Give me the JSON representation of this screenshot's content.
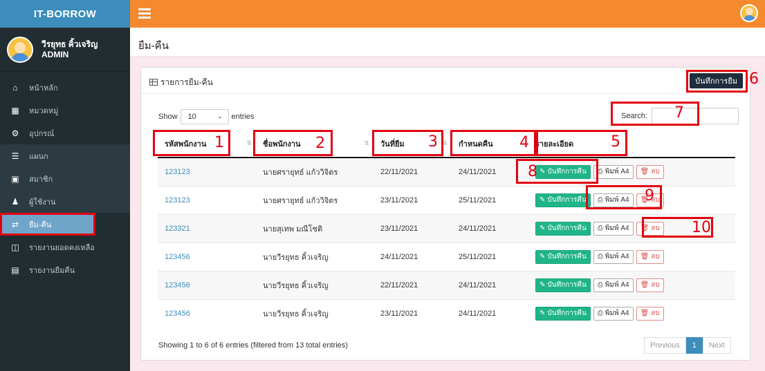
{
  "brand": "IT-BORROW",
  "user": {
    "name": "วีรยุทธ คิ้วเจริญ",
    "role": "ADMIN"
  },
  "menu": [
    {
      "label": "หน้าหลัก",
      "icon": "home-icon"
    },
    {
      "label": "หมวดหมู่",
      "icon": "th-large-icon"
    },
    {
      "label": "อุปกรณ์",
      "icon": "cogs-icon"
    },
    {
      "label": "แผนก",
      "icon": "list-icon"
    },
    {
      "label": "สมาชิก",
      "icon": "id-card-icon"
    },
    {
      "label": "ผู้ใช้งาน",
      "icon": "user-icon"
    },
    {
      "label": "ยืม-คืน",
      "icon": "random-icon"
    },
    {
      "label": "รายงานยอดคงเหลือ",
      "icon": "file-icon"
    },
    {
      "label": "รายงานยืมคืน",
      "icon": "list-alt-icon"
    }
  ],
  "page_title": "ยืม-คืน",
  "box_title": "รายการยืม-คืน",
  "borrow_button": "บันทึกการยืม",
  "show_label": "Show",
  "entries_value": "10",
  "entries_label": "entries",
  "search_label": "Search:",
  "columns": [
    "รหัสพนักงาน",
    "ชื่อพนักงาน",
    "วันที่ยืม",
    "กำหนดคืน",
    "รายละเอียด"
  ],
  "rows": [
    {
      "id": "123123",
      "name": "นายศรายุทธ์ แก้ววิจิตร",
      "borrow": "22/11/2021",
      "due": "24/11/2021"
    },
    {
      "id": "123123",
      "name": "นายศรายุทธ์ แก้ววิจิตร",
      "borrow": "23/11/2021",
      "due": "25/11/2021"
    },
    {
      "id": "123321",
      "name": "นายสุเทพ มณีโชติ",
      "borrow": "23/11/2021",
      "due": "24/11/2021"
    },
    {
      "id": "123456",
      "name": "นายวีรยุทธ คิ้วเจริญ",
      "borrow": "24/11/2021",
      "due": "25/11/2021"
    },
    {
      "id": "123456",
      "name": "นายวีรยุทธ คิ้วเจริญ",
      "borrow": "22/11/2021",
      "due": "24/11/2021"
    },
    {
      "id": "123456",
      "name": "นายวีรยุทธ คิ้วเจริญ",
      "borrow": "23/11/2021",
      "due": "24/11/2021"
    }
  ],
  "row_buttons": {
    "return": "บันทึกการคืน",
    "print": "พิมพ์ A4",
    "delete": "ลบ"
  },
  "footer_info": "Showing 1 to 6 of 6 entries (filtered from 13 total entries)",
  "pagination": {
    "previous": "Previous",
    "page": "1",
    "next": "Next"
  },
  "annotations": [
    "1",
    "2",
    "3",
    "4",
    "5",
    "6",
    "7",
    "8",
    "9",
    "10"
  ],
  "colors": {
    "topbar": "#f4892d",
    "sidebar": "#222d32",
    "brand": "#3c8dbc",
    "annotation": "#e3000f",
    "return_button": "#20b589"
  }
}
